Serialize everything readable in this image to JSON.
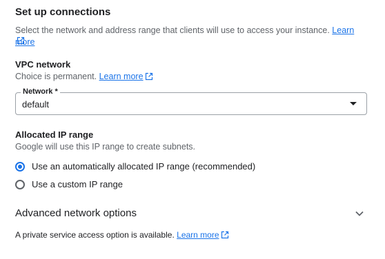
{
  "connections": {
    "title": "Set up connections",
    "description": "Select the network and address range that clients will use to access your instance.",
    "learn_more": "Learn more"
  },
  "vpc": {
    "heading": "VPC network",
    "note": "Choice is permanent.",
    "learn_more": "Learn more",
    "field_label": "Network *",
    "field_value": "default"
  },
  "ip_range": {
    "heading": "Allocated IP range",
    "note": "Google will use this IP range to create subnets.",
    "options": [
      {
        "label": "Use an automatically allocated IP range (recommended)",
        "selected": true
      },
      {
        "label": "Use a custom IP range",
        "selected": false
      }
    ]
  },
  "advanced": {
    "label": "Advanced network options",
    "icon": "chevron-down-icon"
  },
  "footer": {
    "text": "A private service access option is available.",
    "learn_more": "Learn more"
  },
  "colors": {
    "accent": "#1a73e8",
    "text": "#202124",
    "secondary_text": "#5f6368",
    "border": "#9aa0a6"
  }
}
